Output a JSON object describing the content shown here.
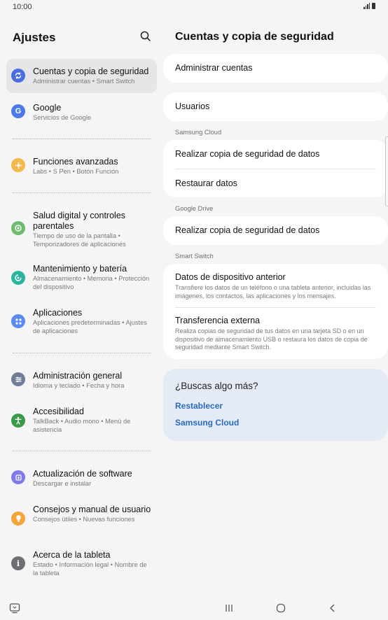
{
  "status": {
    "time": "10:00"
  },
  "left": {
    "title": "Ajustes",
    "items": [
      {
        "title": "Cuentas y copia de seguridad",
        "subtitle": "Administrar cuentas  •  Smart Switch",
        "icon": "sync-icon",
        "color": "#4a6ee0"
      },
      {
        "title": "Google",
        "subtitle": "Servicios de Google",
        "icon": "google-icon",
        "color": "#4b7be8"
      },
      {
        "title": "Funciones avanzadas",
        "subtitle": "Labs  •  S Pen  •  Botón Función",
        "icon": "puzzle-icon",
        "color": "#f2b84a"
      },
      {
        "title": "Salud digital y controles parentales",
        "subtitle": "Tiempo de uso de la pantalla  •  Temporizadores de aplicaciones",
        "icon": "wellbeing-icon",
        "color": "#6dbb6e"
      },
      {
        "title": "Mantenimiento y batería",
        "subtitle": "Almacenamiento  •  Memoria  •  Protección del dispositivo",
        "icon": "care-icon",
        "color": "#2bb5a0"
      },
      {
        "title": "Aplicaciones",
        "subtitle": "Aplicaciones predeterminadas  •  Ajustes de aplicaciones",
        "icon": "apps-icon",
        "color": "#5a8bf0"
      },
      {
        "title": "Administración general",
        "subtitle": "Idioma y teclado  •  Fecha y hora",
        "icon": "sliders-icon",
        "color": "#6f7e96"
      },
      {
        "title": "Accesibilidad",
        "subtitle": "TalkBack  •  Audio mono  •  Menú de asistencia",
        "icon": "accessibility-icon",
        "color": "#3a9a4a"
      },
      {
        "title": "Actualización de software",
        "subtitle": "Descargar e instalar",
        "icon": "update-icon",
        "color": "#7f7be8"
      },
      {
        "title": "Consejos y manual de usuario",
        "subtitle": "Consejos útiles  •  Nuevas funciones",
        "icon": "bulb-icon",
        "color": "#f3a63a"
      },
      {
        "title": "Acerca de la tableta",
        "subtitle": "Estado  •  Información legal  •  Nombre de la tableta",
        "icon": "info-icon",
        "color": "#6e6e73"
      }
    ]
  },
  "right": {
    "title": "Cuentas y copia de seguridad",
    "manage_accounts": "Administrar cuentas",
    "users": "Usuarios",
    "samsung_cloud_label": "Samsung Cloud",
    "backup_data": "Realizar copia de seguridad de datos",
    "restore_data": "Restaurar datos",
    "google_drive_label": "Google Drive",
    "google_backup": "Realizar copia de seguridad de datos",
    "smart_switch_label": "Smart Switch",
    "previous_device": "Datos de dispositivo anterior",
    "previous_device_sub": "Transfiere los datos de un teléfono o una tableta anterior, incluidas las imágenes, los contactos, las aplicaciones y los mensajes.",
    "external_transfer": "Transferencia externa",
    "external_transfer_sub": "Realiza copias de seguridad de tus datos en una tarjeta SD o en un dispositivo de almacenamiento USB o restaura los datos de copia de seguridad mediante Smart Switch.",
    "more_title": "¿Buscas algo más?",
    "more_link_1": "Restablecer",
    "more_link_2": "Samsung Cloud"
  }
}
